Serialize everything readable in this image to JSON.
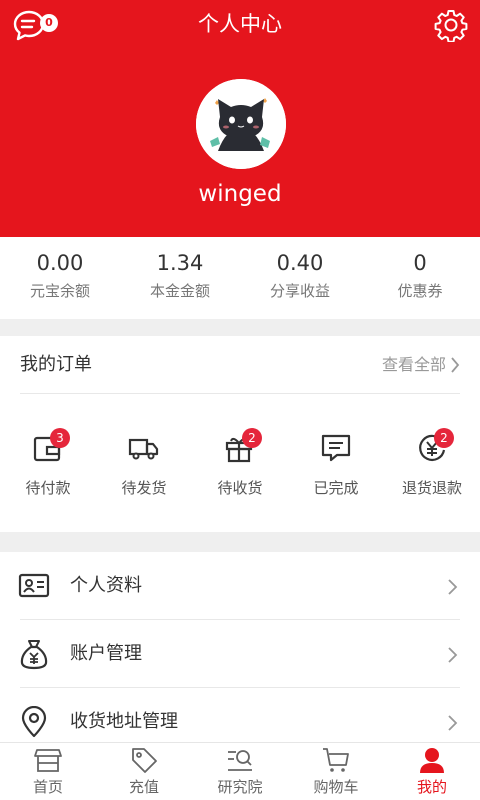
{
  "header": {
    "title": "个人中心",
    "message_badge": "0",
    "username": "winged",
    "bg_color": "#e5151d"
  },
  "stats": [
    {
      "value": "0.00",
      "label": "元宝余额"
    },
    {
      "value": "1.34",
      "label": "本金金额"
    },
    {
      "value": "0.40",
      "label": "分享收益"
    },
    {
      "value": "0",
      "label": "优惠券"
    }
  ],
  "orders": {
    "title": "我的订单",
    "view_all": "查看全部",
    "items": [
      {
        "label": "待付款",
        "badge": "3",
        "icon": "wallet-icon"
      },
      {
        "label": "待发货",
        "badge": "",
        "icon": "truck-icon"
      },
      {
        "label": "待收货",
        "badge": "2",
        "icon": "gift-box-icon"
      },
      {
        "label": "已完成",
        "badge": "",
        "icon": "message-icon"
      },
      {
        "label": "退货退款",
        "badge": "2",
        "icon": "yuan-refund-icon"
      }
    ]
  },
  "menu": [
    {
      "label": "个人资料",
      "icon": "id-card-icon"
    },
    {
      "label": "账户管理",
      "icon": "money-bag-icon"
    },
    {
      "label": "收货地址管理",
      "icon": "location-pin-icon"
    }
  ],
  "tabbar": [
    {
      "label": "首页",
      "icon": "store-icon"
    },
    {
      "label": "充值",
      "icon": "tag-icon"
    },
    {
      "label": "研究院",
      "icon": "search-list-icon"
    },
    {
      "label": "购物车",
      "icon": "cart-icon"
    },
    {
      "label": "我的",
      "icon": "user-icon",
      "active": true
    }
  ]
}
